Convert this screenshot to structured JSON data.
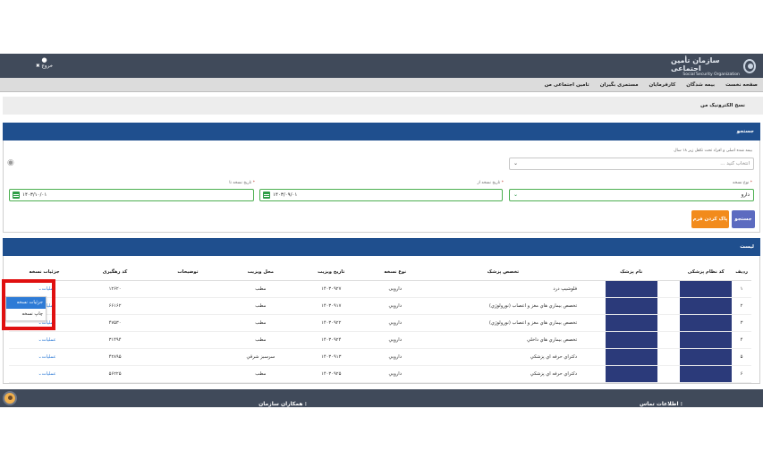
{
  "header": {
    "logo_fa": "سازمان تأمین اجتماعی",
    "logo_en": "Social Security Organization",
    "user_icon": "user-icon",
    "logout": "✖ خروج"
  },
  "nav": {
    "items": [
      "صفحه نخست",
      "بیمه شدگان",
      "کارفرمایان",
      "مستمری بگیران",
      "تامین اجتماعی من"
    ]
  },
  "breadcrumb": "نسخ الکترونیک من",
  "search": {
    "title": "جستجو",
    "insured_label": "بیمه شده اصلی و افراد تحت تکفل زیر ۱۸ سال",
    "insured_placeholder": "انتخاب کنید ...",
    "type_label": "نوع نسخه",
    "type_value": "دارو",
    "from_label": "تاریخ نسخه از",
    "from_value": "۱۴۰۳/۰۹/۰۱",
    "to_label": "تاریخ نسخه تا",
    "to_value": "۱۴۰۳/۱۰/۰۱",
    "required_mark": "*",
    "search_button": "جستجو",
    "clear_button": "پاک کردن فرم"
  },
  "list": {
    "title": "لیست",
    "columns": [
      "ردیف",
      "کد نظام پزشکی",
      "نام پزشک",
      "تخصص پزشک",
      "نوع نسخه",
      "تاریخ ویزیت",
      "محل ویزیت",
      "توضیحات",
      "کد رهگیری",
      "جزئیات نسخه"
    ],
    "rows": [
      {
        "idx": "۱",
        "spec": "فلوشیپ درد",
        "type": "دارویی",
        "date": "۱۴۰۳۰۹۲۷",
        "place": "مطب",
        "desc": "",
        "track": "۱۲۶۲۰",
        "ops": "عملیات"
      },
      {
        "idx": "۲",
        "spec": "تخصص بیماري هاي مغز و اعصاب (نورولوژي)",
        "type": "دارويي",
        "date": "۱۴۰۳۰۹۱۷",
        "place": "مطب",
        "desc": "",
        "track": "۶۶۱۶۲",
        "ops": "عملیات"
      },
      {
        "idx": "۳",
        "spec": "تخصص بیماري هاي مغز و اعصاب (نورولوژي)",
        "type": "دارويي",
        "date": "۱۴۰۳۰۹۲۲",
        "place": "مطب",
        "desc": "",
        "track": "۴۷۵۳۰",
        "ops": "عملیات"
      },
      {
        "idx": "۴",
        "spec": "تخصص بیماري هاي داخلي",
        "type": "دارويي",
        "date": "۱۴۰۳۰۹۲۴",
        "place": "مطب",
        "desc": "",
        "track": "۳۱۴۹۴",
        "ops": "عملیات"
      },
      {
        "idx": "۵",
        "spec": "دکتراي حرفه اي پزشكي",
        "type": "دارويي",
        "date": "۱۴۰۳۰۹۱۳",
        "place": "سرسبز شرقي",
        "desc": "",
        "track": "۴۲۸۹۵",
        "ops": "عملیات"
      },
      {
        "idx": "۶",
        "spec": "دکتراي حرفه اي پزشكي",
        "type": "دارويي",
        "date": "۱۴۰۳۰۹۲۵",
        "place": "مطب",
        "desc": "",
        "track": "۵۶۲۲۵",
        "ops": "عملیات"
      }
    ]
  },
  "dropdown": {
    "items": [
      "جزئیات نسخه",
      "چاپ نسخه"
    ]
  },
  "footer": {
    "contact": "اطلاعات تماس :",
    "partners": "همکاران سازمان :"
  },
  "colors": {
    "header_bg": "#404a5a",
    "panel_blue": "#1f4f8e",
    "mask_blue": "#2b3a7a",
    "accent_green": "#4caf50",
    "orange": "#f28b1c",
    "highlight_red": "#e01010"
  }
}
